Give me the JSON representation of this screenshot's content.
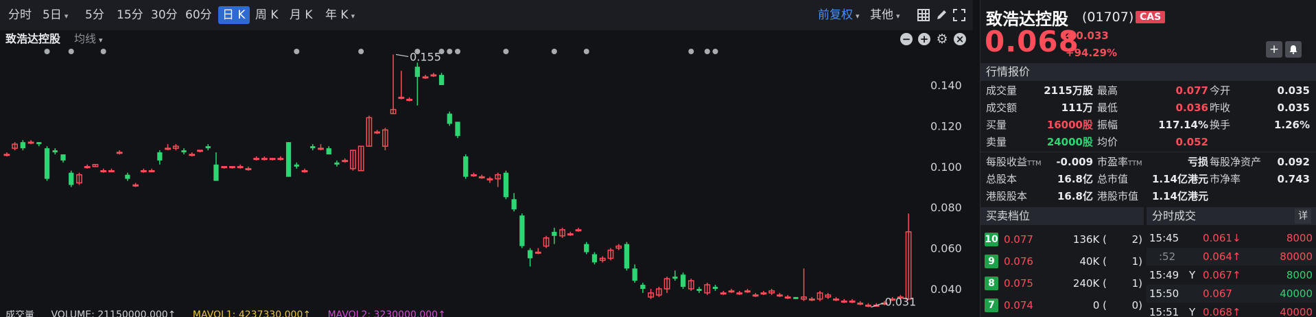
{
  "toolbar": {
    "timeframes": [
      {
        "label": "分时",
        "dropdown": false,
        "active": false
      },
      {
        "label": "5日",
        "dropdown": true,
        "active": false
      },
      {
        "label": "5分",
        "dropdown": false,
        "active": false
      },
      {
        "label": "15分",
        "dropdown": false,
        "active": false
      },
      {
        "label": "30分",
        "dropdown": false,
        "active": false
      },
      {
        "label": "60分",
        "dropdown": false,
        "active": false
      },
      {
        "label": "日 K",
        "dropdown": false,
        "active": true
      },
      {
        "label": "周 K",
        "dropdown": false,
        "active": false
      },
      {
        "label": "月 K",
        "dropdown": false,
        "active": false
      },
      {
        "label": "年 K",
        "dropdown": true,
        "active": false
      }
    ],
    "adjust": "前复权",
    "other": "其他",
    "icons": [
      "grid-layout-icon",
      "pen-draw-icon",
      "fullscreen-icon"
    ]
  },
  "subbar": {
    "stock_name": "致浩达控股",
    "ma_label": "均线"
  },
  "chart_data": {
    "type": "candlestick",
    "y_ticks": [
      "0.140",
      "0.120",
      "0.100",
      "0.080",
      "0.060",
      "0.040"
    ],
    "ylim": [
      0.031,
      0.158
    ],
    "grid": false,
    "high_label": "0.155",
    "low_label": "0.031",
    "candles": [
      {
        "o": 0.106,
        "h": 0.107,
        "l": 0.105,
        "c": 0.106
      },
      {
        "o": 0.109,
        "h": 0.112,
        "l": 0.108,
        "c": 0.111
      },
      {
        "o": 0.112,
        "h": 0.113,
        "l": 0.108,
        "c": 0.109
      },
      {
        "o": 0.112,
        "h": 0.113,
        "l": 0.111,
        "c": 0.112
      },
      {
        "o": 0.112,
        "h": 0.112,
        "l": 0.11,
        "c": 0.111
      },
      {
        "o": 0.109,
        "h": 0.11,
        "l": 0.093,
        "c": 0.094
      },
      {
        "o": 0.108,
        "h": 0.109,
        "l": 0.106,
        "c": 0.107
      },
      {
        "o": 0.106,
        "h": 0.106,
        "l": 0.102,
        "c": 0.103
      },
      {
        "o": 0.097,
        "h": 0.098,
        "l": 0.09,
        "c": 0.091
      },
      {
        "o": 0.092,
        "h": 0.097,
        "l": 0.091,
        "c": 0.096
      },
      {
        "o": 0.1,
        "h": 0.101,
        "l": 0.099,
        "c": 0.1
      },
      {
        "o": 0.1,
        "h": 0.101,
        "l": 0.1,
        "c": 0.101
      },
      {
        "o": 0.098,
        "h": 0.099,
        "l": 0.097,
        "c": 0.098
      },
      {
        "o": 0.098,
        "h": 0.099,
        "l": 0.098,
        "c": 0.098
      },
      {
        "o": 0.107,
        "h": 0.108,
        "l": 0.106,
        "c": 0.107
      },
      {
        "o": 0.096,
        "h": 0.097,
        "l": 0.093,
        "c": 0.094
      },
      {
        "o": 0.091,
        "h": 0.092,
        "l": 0.09,
        "c": 0.091
      },
      {
        "o": 0.098,
        "h": 0.099,
        "l": 0.097,
        "c": 0.098
      },
      {
        "o": 0.098,
        "h": 0.099,
        "l": 0.098,
        "c": 0.098
      },
      {
        "o": 0.107,
        "h": 0.108,
        "l": 0.101,
        "c": 0.103
      },
      {
        "o": 0.109,
        "h": 0.111,
        "l": 0.108,
        "c": 0.109
      },
      {
        "o": 0.109,
        "h": 0.111,
        "l": 0.108,
        "c": 0.11
      },
      {
        "o": 0.108,
        "h": 0.109,
        "l": 0.106,
        "c": 0.107
      },
      {
        "o": 0.106,
        "h": 0.107,
        "l": 0.105,
        "c": 0.106
      },
      {
        "o": 0.108,
        "h": 0.108,
        "l": 0.107,
        "c": 0.108
      },
      {
        "o": 0.11,
        "h": 0.111,
        "l": 0.108,
        "c": 0.109
      },
      {
        "o": 0.101,
        "h": 0.107,
        "l": 0.093,
        "c": 0.093
      },
      {
        "o": 0.1,
        "h": 0.1,
        "l": 0.099,
        "c": 0.1
      },
      {
        "o": 0.1,
        "h": 0.1,
        "l": 0.099,
        "c": 0.1
      },
      {
        "o": 0.1,
        "h": 0.101,
        "l": 0.099,
        "c": 0.1
      },
      {
        "o": 0.099,
        "h": 0.1,
        "l": 0.098,
        "c": 0.099
      },
      {
        "o": 0.104,
        "h": 0.105,
        "l": 0.103,
        "c": 0.104
      },
      {
        "o": 0.104,
        "h": 0.105,
        "l": 0.103,
        "c": 0.104
      },
      {
        "o": 0.104,
        "h": 0.104,
        "l": 0.103,
        "c": 0.104
      },
      {
        "o": 0.104,
        "h": 0.105,
        "l": 0.103,
        "c": 0.104
      },
      {
        "o": 0.112,
        "h": 0.112,
        "l": 0.095,
        "c": 0.095
      },
      {
        "o": 0.101,
        "h": 0.102,
        "l": 0.099,
        "c": 0.1
      },
      {
        "o": 0.098,
        "h": 0.099,
        "l": 0.097,
        "c": 0.098
      },
      {
        "o": 0.11,
        "h": 0.111,
        "l": 0.108,
        "c": 0.109
      },
      {
        "o": 0.109,
        "h": 0.111,
        "l": 0.108,
        "c": 0.109
      },
      {
        "o": 0.109,
        "h": 0.11,
        "l": 0.106,
        "c": 0.106
      },
      {
        "o": 0.102,
        "h": 0.103,
        "l": 0.1,
        "c": 0.101
      },
      {
        "o": 0.103,
        "h": 0.104,
        "l": 0.102,
        "c": 0.103
      },
      {
        "o": 0.099,
        "h": 0.108,
        "l": 0.098,
        "c": 0.108
      },
      {
        "o": 0.098,
        "h": 0.11,
        "l": 0.098,
        "c": 0.11
      },
      {
        "o": 0.11,
        "h": 0.125,
        "l": 0.11,
        "c": 0.124
      },
      {
        "o": 0.117,
        "h": 0.118,
        "l": 0.116,
        "c": 0.117
      },
      {
        "o": 0.11,
        "h": 0.119,
        "l": 0.108,
        "c": 0.118
      },
      {
        "o": 0.126,
        "h": 0.155,
        "l": 0.126,
        "c": 0.128
      },
      {
        "o": 0.134,
        "h": 0.147,
        "l": 0.133,
        "c": 0.134
      },
      {
        "o": 0.133,
        "h": 0.134,
        "l": 0.132,
        "c": 0.133
      },
      {
        "o": 0.149,
        "h": 0.151,
        "l": 0.13,
        "c": 0.144
      },
      {
        "o": 0.144,
        "h": 0.145,
        "l": 0.143,
        "c": 0.144
      },
      {
        "o": 0.145,
        "h": 0.146,
        "l": 0.144,
        "c": 0.145
      },
      {
        "o": 0.145,
        "h": 0.146,
        "l": 0.14,
        "c": 0.14
      },
      {
        "o": 0.126,
        "h": 0.127,
        "l": 0.12,
        "c": 0.121
      },
      {
        "o": 0.122,
        "h": 0.122,
        "l": 0.114,
        "c": 0.115
      },
      {
        "o": 0.105,
        "h": 0.106,
        "l": 0.094,
        "c": 0.095
      },
      {
        "o": 0.096,
        "h": 0.097,
        "l": 0.095,
        "c": 0.096
      },
      {
        "o": 0.095,
        "h": 0.096,
        "l": 0.094,
        "c": 0.095
      },
      {
        "o": 0.094,
        "h": 0.095,
        "l": 0.092,
        "c": 0.094
      },
      {
        "o": 0.094,
        "h": 0.097,
        "l": 0.09,
        "c": 0.096
      },
      {
        "o": 0.097,
        "h": 0.098,
        "l": 0.084,
        "c": 0.085
      },
      {
        "o": 0.084,
        "h": 0.087,
        "l": 0.078,
        "c": 0.079
      },
      {
        "o": 0.076,
        "h": 0.077,
        "l": 0.06,
        "c": 0.061
      },
      {
        "o": 0.059,
        "h": 0.06,
        "l": 0.051,
        "c": 0.055
      },
      {
        "o": 0.058,
        "h": 0.06,
        "l": 0.057,
        "c": 0.058
      },
      {
        "o": 0.061,
        "h": 0.066,
        "l": 0.06,
        "c": 0.065
      },
      {
        "o": 0.068,
        "h": 0.07,
        "l": 0.062,
        "c": 0.066
      },
      {
        "o": 0.066,
        "h": 0.07,
        "l": 0.065,
        "c": 0.069
      },
      {
        "o": 0.067,
        "h": 0.068,
        "l": 0.066,
        "c": 0.067
      },
      {
        "o": 0.069,
        "h": 0.07,
        "l": 0.068,
        "c": 0.069
      },
      {
        "o": 0.062,
        "h": 0.063,
        "l": 0.057,
        "c": 0.058
      },
      {
        "o": 0.057,
        "h": 0.058,
        "l": 0.052,
        "c": 0.053
      },
      {
        "o": 0.054,
        "h": 0.056,
        "l": 0.053,
        "c": 0.055
      },
      {
        "o": 0.055,
        "h": 0.06,
        "l": 0.054,
        "c": 0.059
      },
      {
        "o": 0.06,
        "h": 0.062,
        "l": 0.059,
        "c": 0.061
      },
      {
        "o": 0.062,
        "h": 0.063,
        "l": 0.049,
        "c": 0.05
      },
      {
        "o": 0.05,
        "h": 0.052,
        "l": 0.043,
        "c": 0.044
      },
      {
        "o": 0.042,
        "h": 0.043,
        "l": 0.038,
        "c": 0.04
      },
      {
        "o": 0.036,
        "h": 0.04,
        "l": 0.035,
        "c": 0.038
      },
      {
        "o": 0.037,
        "h": 0.041,
        "l": 0.036,
        "c": 0.04
      },
      {
        "o": 0.04,
        "h": 0.046,
        "l": 0.038,
        "c": 0.045
      },
      {
        "o": 0.046,
        "h": 0.049,
        "l": 0.044,
        "c": 0.045
      },
      {
        "o": 0.047,
        "h": 0.048,
        "l": 0.04,
        "c": 0.041
      },
      {
        "o": 0.04,
        "h": 0.045,
        "l": 0.039,
        "c": 0.044
      },
      {
        "o": 0.04,
        "h": 0.041,
        "l": 0.038,
        "c": 0.039
      },
      {
        "o": 0.038,
        "h": 0.043,
        "l": 0.037,
        "c": 0.042
      },
      {
        "o": 0.041,
        "h": 0.042,
        "l": 0.039,
        "c": 0.04
      },
      {
        "o": 0.038,
        "h": 0.039,
        "l": 0.037,
        "c": 0.038
      },
      {
        "o": 0.039,
        "h": 0.04,
        "l": 0.038,
        "c": 0.039
      },
      {
        "o": 0.038,
        "h": 0.039,
        "l": 0.037,
        "c": 0.038
      },
      {
        "o": 0.039,
        "h": 0.04,
        "l": 0.038,
        "c": 0.039
      },
      {
        "o": 0.037,
        "h": 0.038,
        "l": 0.036,
        "c": 0.037
      },
      {
        "o": 0.038,
        "h": 0.039,
        "l": 0.037,
        "c": 0.038
      },
      {
        "o": 0.038,
        "h": 0.04,
        "l": 0.037,
        "c": 0.039
      },
      {
        "o": 0.037,
        "h": 0.038,
        "l": 0.036,
        "c": 0.037
      },
      {
        "o": 0.036,
        "h": 0.037,
        "l": 0.035,
        "c": 0.036
      },
      {
        "o": 0.036,
        "h": 0.036,
        "l": 0.035,
        "c": 0.035
      },
      {
        "o": 0.035,
        "h": 0.05,
        "l": 0.034,
        "c": 0.036
      },
      {
        "o": 0.035,
        "h": 0.036,
        "l": 0.034,
        "c": 0.035
      },
      {
        "o": 0.035,
        "h": 0.039,
        "l": 0.034,
        "c": 0.038
      },
      {
        "o": 0.036,
        "h": 0.038,
        "l": 0.035,
        "c": 0.037
      },
      {
        "o": 0.035,
        "h": 0.036,
        "l": 0.034,
        "c": 0.035
      },
      {
        "o": 0.034,
        "h": 0.035,
        "l": 0.033,
        "c": 0.034
      },
      {
        "o": 0.034,
        "h": 0.035,
        "l": 0.033,
        "c": 0.034
      },
      {
        "o": 0.033,
        "h": 0.034,
        "l": 0.032,
        "c": 0.033
      },
      {
        "o": 0.032,
        "h": 0.033,
        "l": 0.031,
        "c": 0.032
      },
      {
        "o": 0.032,
        "h": 0.033,
        "l": 0.032,
        "c": 0.032
      },
      {
        "o": 0.033,
        "h": 0.034,
        "l": 0.032,
        "c": 0.033
      },
      {
        "o": 0.035,
        "h": 0.036,
        "l": 0.034,
        "c": 0.035
      },
      {
        "o": 0.036,
        "h": 0.037,
        "l": 0.035,
        "c": 0.036
      },
      {
        "o": 0.035,
        "h": 0.077,
        "l": 0.035,
        "c": 0.068
      }
    ],
    "event_dot_candles": [
      5,
      8,
      12,
      36,
      44,
      51,
      54,
      55,
      56,
      62,
      68,
      72,
      85,
      87,
      88
    ],
    "colors": {
      "up": "#ff4d5a",
      "down": "#2ed573",
      "axis_text": "#d0d3d8",
      "dot": "#a8abb0"
    }
  },
  "volume_bar": {
    "label": "成交量",
    "volume": "VOLUME: 21150000.000↑",
    "mavol1": "MAVOL1: 4237330.000↑",
    "mavol2": "MAVOL2: 3230000.000↑"
  },
  "quote": {
    "name": "致浩达控股",
    "code": "(01707)",
    "badge": "CAS",
    "price": "0.068",
    "change": "0.033",
    "change_pct": "+94.29%",
    "section_quote": "行情报价",
    "rows1": [
      [
        {
          "k": "成交量",
          "v": "2115万股",
          "c": ""
        },
        {
          "k": "最高",
          "v": "0.077",
          "c": "red"
        },
        {
          "k": "今开",
          "v": "0.035",
          "c": ""
        }
      ],
      [
        {
          "k": "成交额",
          "v": "111万",
          "c": ""
        },
        {
          "k": "最低",
          "v": "0.036",
          "c": "red"
        },
        {
          "k": "昨收",
          "v": "0.035",
          "c": ""
        }
      ],
      [
        {
          "k": "买量",
          "v": "16000股",
          "c": "red"
        },
        {
          "k": "振幅",
          "v": "117.14%",
          "c": ""
        },
        {
          "k": "换手",
          "v": "1.26%",
          "c": ""
        }
      ],
      [
        {
          "k": "卖量",
          "v": "24000股",
          "c": "green"
        },
        {
          "k": "均价",
          "v": "0.052",
          "c": "red"
        },
        {
          "k": "",
          "v": "",
          "c": ""
        }
      ]
    ],
    "rows2": [
      [
        {
          "k": "每股收益",
          "sub": "TTM",
          "v": "-0.009"
        },
        {
          "k": "市盈率",
          "sub": "TTM",
          "v": "亏损"
        },
        {
          "k": "每股净资产",
          "sub": "",
          "v": "0.092"
        }
      ],
      [
        {
          "k": "总股本",
          "sub": "",
          "v": "16.8亿"
        },
        {
          "k": "总市值",
          "sub": "",
          "v": "1.14亿港元"
        },
        {
          "k": "市净率",
          "sub": "",
          "v": "0.743"
        }
      ],
      [
        {
          "k": "港股股本",
          "sub": "",
          "v": "16.8亿"
        },
        {
          "k": "港股市值",
          "sub": "",
          "v": "1.14亿港元"
        },
        {
          "k": "",
          "sub": "",
          "v": ""
        }
      ]
    ],
    "section_orders": "买卖档位",
    "section_ticks": "分时成交",
    "ticks_detail": "详",
    "orders": [
      {
        "idx": "10",
        "price": "0.077",
        "vol": "136K (",
        "cnt": "2)"
      },
      {
        "idx": "9",
        "price": "0.076",
        "vol": "40K (",
        "cnt": "1)"
      },
      {
        "idx": "8",
        "price": "0.075",
        "vol": "240K (",
        "cnt": "1)"
      },
      {
        "idx": "7",
        "price": "0.074",
        "vol": "0 (",
        "cnt": "0)"
      }
    ],
    "ticks": [
      {
        "time": "15:45",
        "flag": "",
        "price": "0.061↓",
        "price_c": "red",
        "vol": "8000",
        "vol_c": "red"
      },
      {
        "time": ":52",
        "flag": "",
        "price": "0.064↑",
        "price_c": "red",
        "vol": "80000",
        "vol_c": "red"
      },
      {
        "time": "15:49",
        "flag": "Y",
        "price": "0.067↑",
        "price_c": "red",
        "vol": "8000",
        "vol_c": "green"
      },
      {
        "time": "15:50",
        "flag": "",
        "price": "0.067",
        "price_c": "red",
        "vol": "40000",
        "vol_c": "green"
      },
      {
        "time": "15:51",
        "flag": "Y",
        "price": "0.068↑",
        "price_c": "red",
        "vol": "40000",
        "vol_c": "red"
      }
    ]
  }
}
